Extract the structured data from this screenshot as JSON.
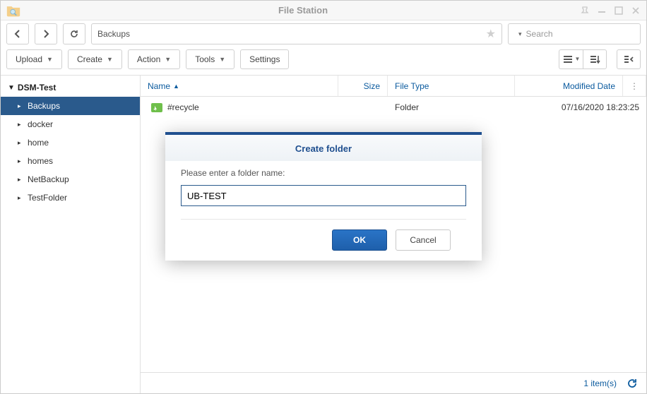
{
  "app": {
    "title": "File Station"
  },
  "path": {
    "value": "Backups"
  },
  "search": {
    "placeholder": "Search"
  },
  "toolbar": {
    "upload": "Upload",
    "create": "Create",
    "action": "Action",
    "tools": "Tools",
    "settings": "Settings"
  },
  "tree": {
    "root": "DSM-Test",
    "items": [
      {
        "label": "Backups",
        "selected": true
      },
      {
        "label": "docker",
        "selected": false
      },
      {
        "label": "home",
        "selected": false
      },
      {
        "label": "homes",
        "selected": false
      },
      {
        "label": "NetBackup",
        "selected": false
      },
      {
        "label": "TestFolder",
        "selected": false
      }
    ]
  },
  "columns": {
    "name": "Name",
    "size": "Size",
    "type": "File Type",
    "modified": "Modified Date"
  },
  "files": [
    {
      "name": "#recycle",
      "size": "",
      "type": "Folder",
      "modified": "07/16/2020 18:23:25"
    }
  ],
  "status": {
    "count": "1 item(s)"
  },
  "dialog": {
    "title": "Create folder",
    "prompt": "Please enter a folder name:",
    "value": "UB-TEST",
    "ok": "OK",
    "cancel": "Cancel"
  }
}
